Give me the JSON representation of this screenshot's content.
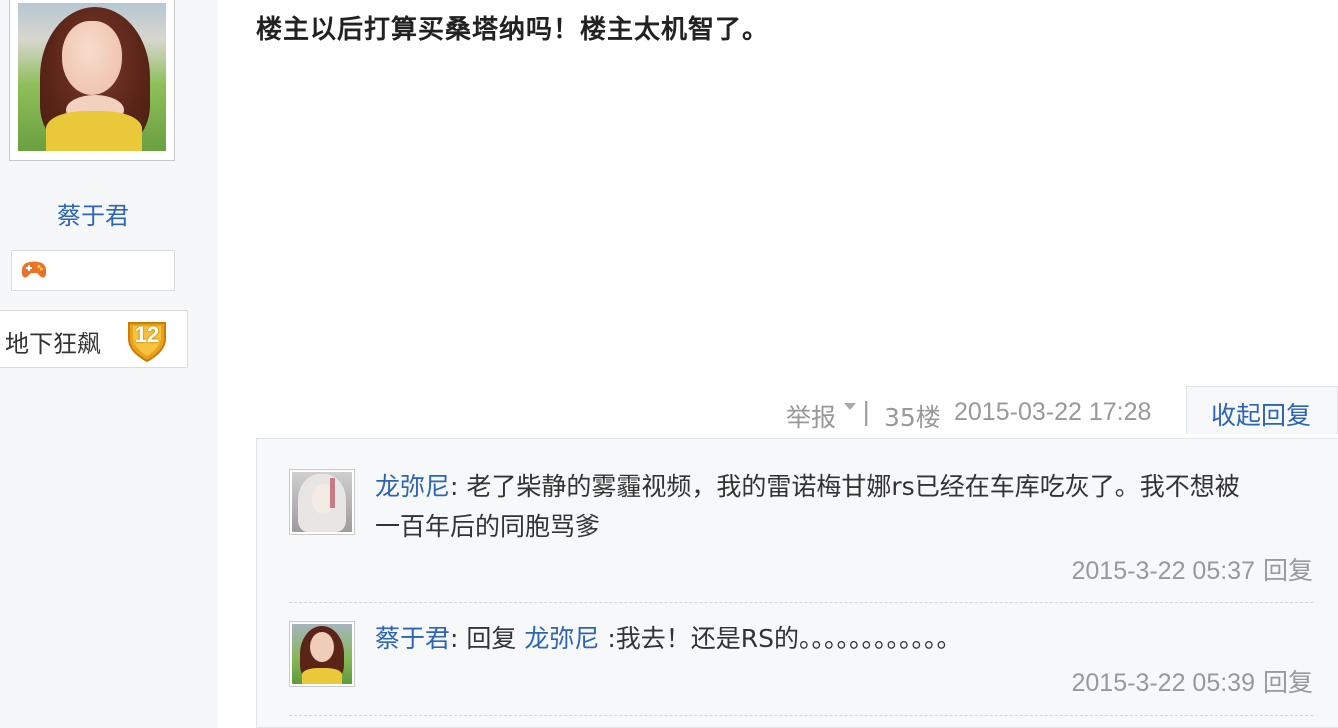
{
  "author": {
    "name": "蔡于君",
    "level_name": "地下狂飙",
    "level": "12"
  },
  "post": {
    "content": "楼主以后打算买桑塔纳吗！楼主太机智了。",
    "report_label": "举报",
    "separator": "|",
    "floor": "35楼",
    "date": "2015-03-22 17:28",
    "collapse_label": "收起回复"
  },
  "replies": [
    {
      "user": "龙弥尼",
      "sep": ":",
      "text_line1": " 老了柴静的雾霾视频，我的雷诺梅甘娜rs已经在车库吃灰了。我不想被",
      "text_line2": "一百年后的同胞骂爹",
      "time": "2015-3-22 05:37",
      "reply_label": "回复"
    },
    {
      "user": "蔡于君",
      "sep": ":",
      "prefix": " 回复 ",
      "target": "龙弥尼",
      "text": " :我去！还是RS的。。。。。。。。。。。。",
      "time": "2015-3-22 05:39",
      "reply_label": "回复"
    }
  ],
  "colors": {
    "link": "#2d64b3",
    "muted": "#999999",
    "reply_bg": "#f7f8fa",
    "sidebar_bg": "#f6f7f9",
    "badge": "#e9a21c"
  }
}
